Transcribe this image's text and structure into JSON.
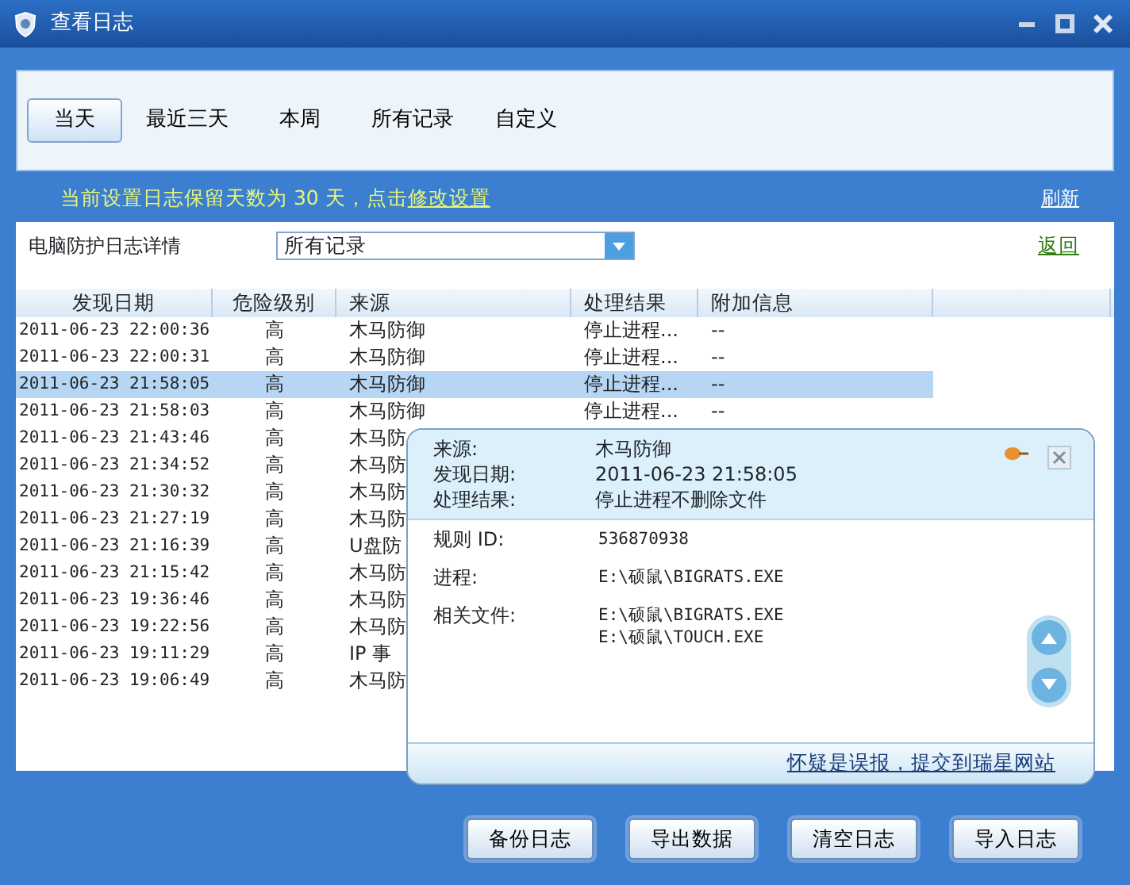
{
  "window": {
    "title": "查看日志"
  },
  "tabs": [
    {
      "label": "当天",
      "selected": true
    },
    {
      "label": "最近三天",
      "selected": false
    },
    {
      "label": "本周",
      "selected": false
    },
    {
      "label": "所有记录",
      "selected": false
    },
    {
      "label": "自定义",
      "selected": false
    }
  ],
  "retention_notice": {
    "text": "当前设置日志保留天数为 30 天，点击",
    "link": "修改设置"
  },
  "refresh_link": "刷新",
  "log_panel": {
    "title": "电脑防护日志详情",
    "filter": {
      "value": "所有记录"
    },
    "back_link": "返回"
  },
  "table": {
    "columns": [
      "发现日期",
      "危险级别",
      "来源",
      "处理结果",
      "附加信息"
    ],
    "rows": [
      {
        "cells": [
          "2011-06-23 22:00:36",
          "高",
          "木马防御",
          "停止进程...",
          "--"
        ],
        "selected": false
      },
      {
        "cells": [
          "2011-06-23 22:00:31",
          "高",
          "木马防御",
          "停止进程...",
          "--"
        ],
        "selected": false
      },
      {
        "cells": [
          "2011-06-23 21:58:05",
          "高",
          "木马防御",
          "停止进程...",
          "--"
        ],
        "selected": true
      },
      {
        "cells": [
          "2011-06-23 21:58:03",
          "高",
          "木马防御",
          "停止进程...",
          "--"
        ],
        "selected": false
      },
      {
        "cells": [
          "2011-06-23 21:43:46",
          "高",
          "木马防"
        ],
        "selected": false
      },
      {
        "cells": [
          "2011-06-23 21:34:52",
          "高",
          "木马防"
        ],
        "selected": false
      },
      {
        "cells": [
          "2011-06-23 21:30:32",
          "高",
          "木马防"
        ],
        "selected": false
      },
      {
        "cells": [
          "2011-06-23 21:27:19",
          "高",
          "木马防"
        ],
        "selected": false
      },
      {
        "cells": [
          "2011-06-23 21:16:39",
          "高",
          "U盘防"
        ],
        "selected": false
      },
      {
        "cells": [
          "2011-06-23 21:15:42",
          "高",
          "木马防"
        ],
        "selected": false
      },
      {
        "cells": [
          "2011-06-23 19:36:46",
          "高",
          "木马防"
        ],
        "selected": false
      },
      {
        "cells": [
          "2011-06-23 19:22:56",
          "高",
          "木马防"
        ],
        "selected": false
      },
      {
        "cells": [
          "2011-06-23 19:11:29",
          "高",
          "IP 事"
        ],
        "selected": false
      },
      {
        "cells": [
          "2011-06-23 19:06:49",
          "高",
          "木马防"
        ],
        "selected": false
      }
    ]
  },
  "detail_popup": {
    "header_fields": [
      {
        "label": "来源:",
        "value": "木马防御"
      },
      {
        "label": "发现日期:",
        "value": "2011-06-23 21:58:05"
      },
      {
        "label": "处理结果:",
        "value": "停止进程不删除文件"
      }
    ],
    "body_fields": [
      {
        "label": "规则 ID:",
        "values": [
          "536870938"
        ]
      },
      {
        "label": "进程:",
        "values": [
          "E:\\硕鼠\\BIGRATS.EXE"
        ]
      },
      {
        "label": "相关文件:",
        "values": [
          "E:\\硕鼠\\BIGRATS.EXE",
          "E:\\硕鼠\\TOUCH.EXE"
        ]
      }
    ],
    "report_link": "怀疑是误报，提交到瑞星网站"
  },
  "buttons": [
    "备份日志",
    "导出数据",
    "清空日志",
    "导入日志"
  ]
}
